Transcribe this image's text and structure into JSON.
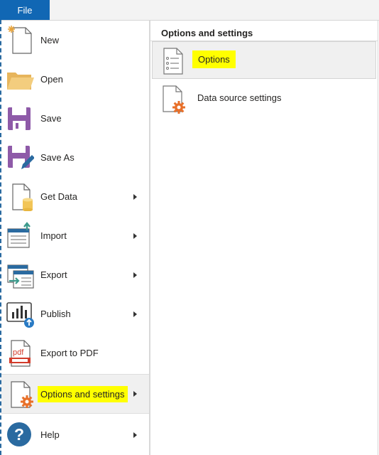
{
  "file_tab": {
    "label": "File"
  },
  "menu": {
    "items": [
      {
        "label": "New",
        "icon": "new-file-icon",
        "submenu": false
      },
      {
        "label": "Open",
        "icon": "folder-icon",
        "submenu": false
      },
      {
        "label": "Save",
        "icon": "save-icon",
        "submenu": false
      },
      {
        "label": "Save As",
        "icon": "save-as-icon",
        "submenu": false
      },
      {
        "label": "Get Data",
        "icon": "get-data-icon",
        "submenu": true
      },
      {
        "label": "Import",
        "icon": "import-icon",
        "submenu": true
      },
      {
        "label": "Export",
        "icon": "export-icon",
        "submenu": true
      },
      {
        "label": "Publish",
        "icon": "publish-icon",
        "submenu": true
      },
      {
        "label": "Export to PDF",
        "icon": "pdf-icon",
        "submenu": false
      },
      {
        "label": "Options and settings",
        "icon": "options-settings-icon",
        "submenu": true,
        "selected": true,
        "highlighted": true
      },
      {
        "label": "Help",
        "icon": "help-icon",
        "submenu": true
      }
    ]
  },
  "submenu": {
    "title": "Options and settings",
    "items": [
      {
        "label": "Options",
        "icon": "options-list-icon",
        "selected": true,
        "highlighted": true
      },
      {
        "label": "Data source settings",
        "icon": "data-source-settings-icon"
      }
    ]
  },
  "colors": {
    "accent": "#1167b4",
    "highlight": "#ffff00",
    "orange_gear": "#e8702a",
    "purple_save": "#8e5aa8"
  }
}
